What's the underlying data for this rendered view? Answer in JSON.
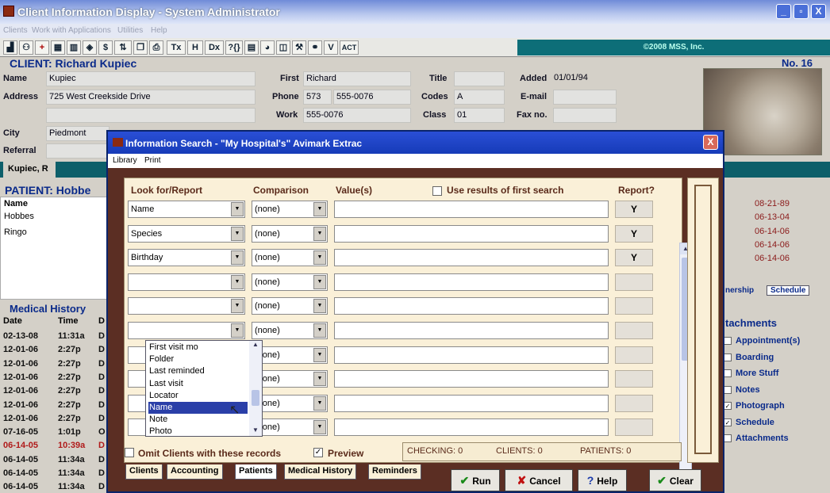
{
  "window": {
    "title": "Client Information Display - System Administrator",
    "min": "_",
    "max": "▫",
    "close": "X"
  },
  "menubar": [
    "Clients",
    "Work with",
    "Applications",
    "Utilities",
    "Help"
  ],
  "toolbar": {
    "buttons": [
      "Tx",
      "H",
      "Dx",
      "?{}",
      "ACT"
    ],
    "copyright": "©2008 MSS, Inc."
  },
  "client": {
    "header": "CLIENT:  Richard Kupiec",
    "number": "No. 16",
    "name_label": "Name",
    "name": "Kupiec",
    "address_label": "Address",
    "address": "725 West Creekside Drive",
    "city_label": "City",
    "city": "Piedmont",
    "referral_label": "Referral",
    "first_label": "First",
    "first": "Richard",
    "phone_label": "Phone",
    "phone_area": "573",
    "phone": "555-0076",
    "work_label": "Work",
    "work": "555-0076",
    "title_label": "Title",
    "codes_label": "Codes",
    "codes": "A",
    "class_label": "Class",
    "class": "01",
    "added_label": "Added",
    "added": "01/01/94",
    "email_label": "E-mail",
    "fax_label": "Fax no.",
    "tab": "Kupiec, R"
  },
  "patient": {
    "header": "PATIENT:  Hobbe",
    "name_label": "Name",
    "rows": [
      "Hobbes",
      "Ringo"
    ]
  },
  "medical_history": {
    "header": "Medical History",
    "cols": [
      "Date",
      "Time",
      "D"
    ],
    "rows": [
      {
        "date": "02-13-08",
        "time": "11:31a",
        "d": "D"
      },
      {
        "date": "12-01-06",
        "time": "2:27p",
        "d": "D"
      },
      {
        "date": "12-01-06",
        "time": "2:27p",
        "d": "D"
      },
      {
        "date": "12-01-06",
        "time": "2:27p",
        "d": "D"
      },
      {
        "date": "12-01-06",
        "time": "2:27p",
        "d": "D"
      },
      {
        "date": "12-01-06",
        "time": "2:27p",
        "d": "D"
      },
      {
        "date": "12-01-06",
        "time": "2:27p",
        "d": "D"
      },
      {
        "date": "07-16-05",
        "time": "1:01p",
        "d": "O"
      },
      {
        "date": "06-14-05",
        "time": "10:39a",
        "d": "D"
      },
      {
        "date": "06-14-05",
        "time": "11:34a",
        "d": "D"
      },
      {
        "date": "06-14-05",
        "time": "11:34a",
        "d": "D"
      },
      {
        "date": "06-14-05",
        "time": "11:34a",
        "d": "D"
      }
    ]
  },
  "right_dates": [
    "08-21-89",
    "06-13-04",
    "06-14-06",
    "06-14-06",
    "06-14-06"
  ],
  "right_tabs": [
    "nership",
    "Schedule"
  ],
  "attachments": {
    "header": "tachments",
    "items": [
      "Appointment(s)",
      "Boarding",
      "More Stuff",
      "Notes",
      "Photograph",
      "Schedule",
      "Attachments"
    ]
  },
  "dialog": {
    "title": "Information Search - \"My Hospital's\" Avimark Extrac",
    "close": "X",
    "menu": [
      "Library",
      "Print"
    ],
    "col_look": "Look for/Report",
    "col_comparison": "Comparison",
    "col_values": "Value(s)",
    "use_results": "Use results of first search",
    "col_report": "Report?",
    "rows": [
      {
        "field": "Name",
        "comparison": "(none)",
        "report": "Y"
      },
      {
        "field": "Species",
        "comparison": "(none)",
        "report": "Y"
      },
      {
        "field": "Birthday",
        "comparison": "(none)",
        "report": "Y"
      },
      {
        "field": "",
        "comparison": "(none)",
        "report": ""
      },
      {
        "field": "",
        "comparison": "(none)",
        "report": ""
      },
      {
        "field": "",
        "comparison": "(none)",
        "report": ""
      },
      {
        "field": "",
        "comparison": "(none)",
        "report": ""
      },
      {
        "field": "",
        "comparison": "(none)",
        "report": ""
      },
      {
        "field": "",
        "comparison": "(none)",
        "report": ""
      },
      {
        "field": "",
        "comparison": "(none)",
        "report": ""
      }
    ],
    "dropdown_items": [
      "First visit mo",
      "Folder",
      "Last reminded",
      "Last visit",
      "Locator",
      "Name",
      "Note",
      "Photo"
    ],
    "dropdown_selected": "Name",
    "omit_label": "Omit Clients with these records",
    "preview_label": "Preview",
    "preview_checked": "✓",
    "checking": "CHECKING: 0",
    "clients": "CLIENTS: 0",
    "patients": "PATIENTS: 0",
    "tabs": [
      "Clients",
      "Accounting",
      "Patients",
      "Medical History",
      "Reminders"
    ],
    "active_tab": "Patients",
    "buttons": {
      "run": "Run",
      "cancel": "Cancel",
      "help": "Help",
      "clear": "Clear"
    }
  }
}
